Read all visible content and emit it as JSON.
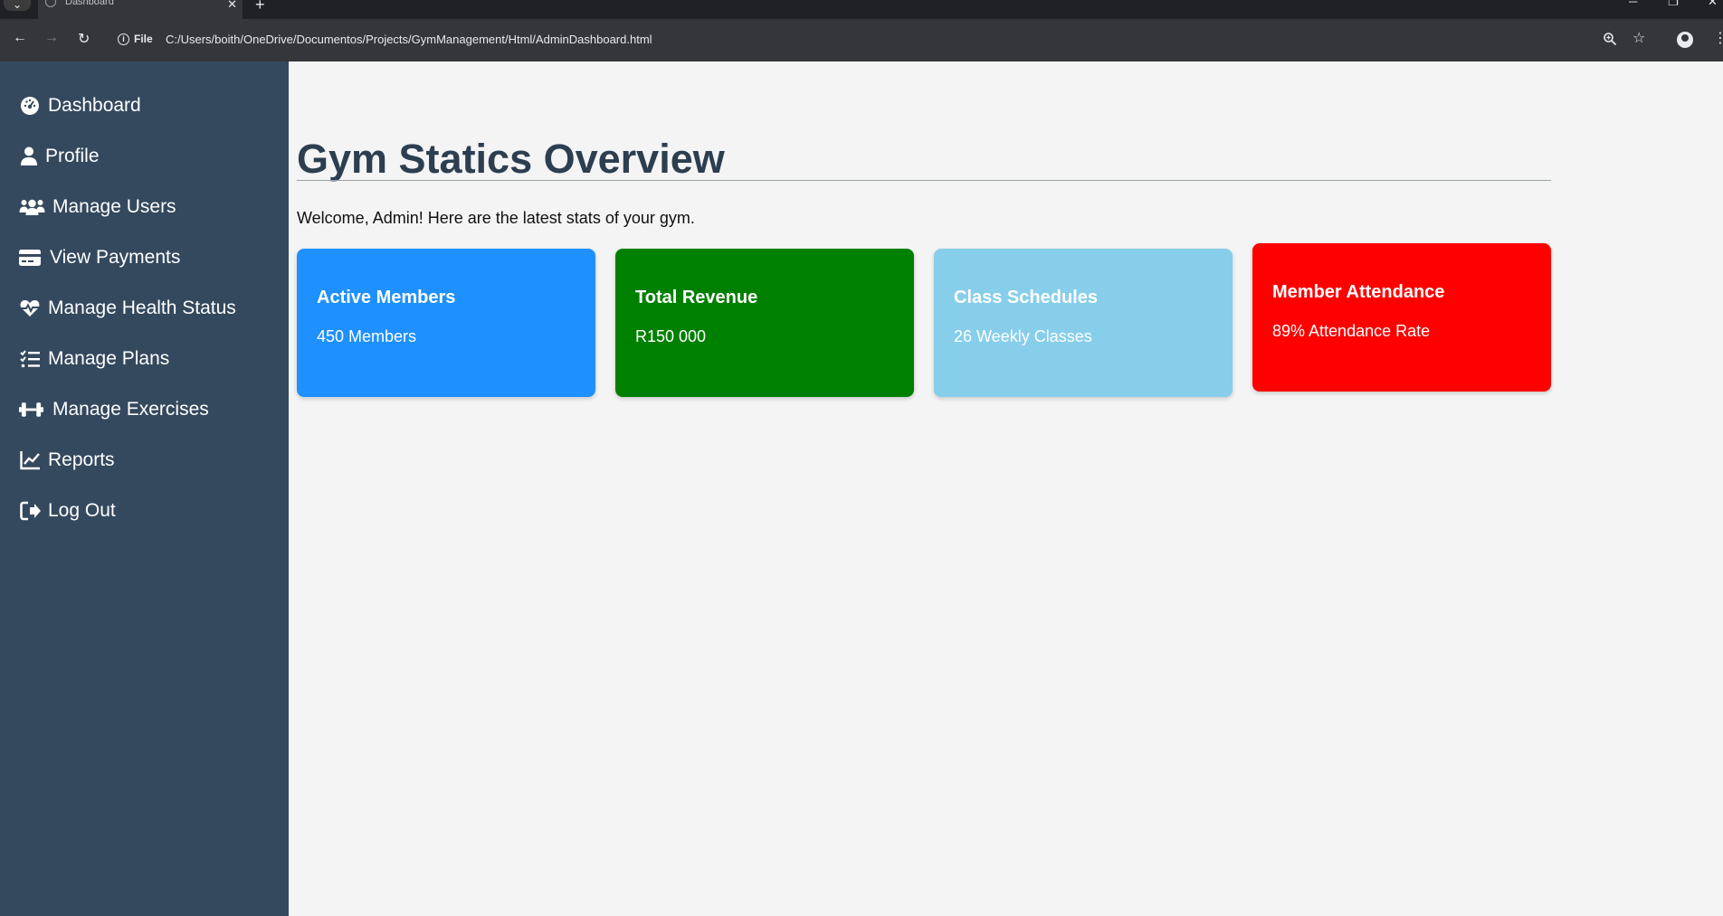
{
  "browser": {
    "tab_title": "Dashboard",
    "scheme_label": "File",
    "url": "C:/Users/boith/OneDrive/Documentos/Projects/GymManagement/Html/AdminDashboard.html"
  },
  "sidebar": {
    "items": [
      {
        "label": "Dashboard",
        "icon": "dashboard-gauge-icon"
      },
      {
        "label": "Profile",
        "icon": "user-icon"
      },
      {
        "label": "Manage Users",
        "icon": "users-icon"
      },
      {
        "label": "View Payments",
        "icon": "credit-card-icon"
      },
      {
        "label": "Manage Health Status",
        "icon": "heart-pulse-icon"
      },
      {
        "label": "Manage Plans",
        "icon": "list-check-icon"
      },
      {
        "label": "Manage Exercises",
        "icon": "dumbbell-icon"
      },
      {
        "label": "Reports",
        "icon": "chart-line-icon"
      },
      {
        "label": "Log Out",
        "icon": "sign-out-icon"
      }
    ]
  },
  "main": {
    "title": "Gym Statics Overview",
    "welcome": "Welcome, Admin! Here are the latest stats of your gym.",
    "cards": [
      {
        "title": "Active Members",
        "value": "450 Members",
        "color": "#1e90ff"
      },
      {
        "title": "Total Revenue",
        "value": "R150 000",
        "color": "#008000"
      },
      {
        "title": "Class Schedules",
        "value": "26 Weekly Classes",
        "color": "#87ceeb"
      },
      {
        "title": "Member Attendance",
        "value": "89% Attendance Rate",
        "color": "#ff0000"
      }
    ]
  }
}
